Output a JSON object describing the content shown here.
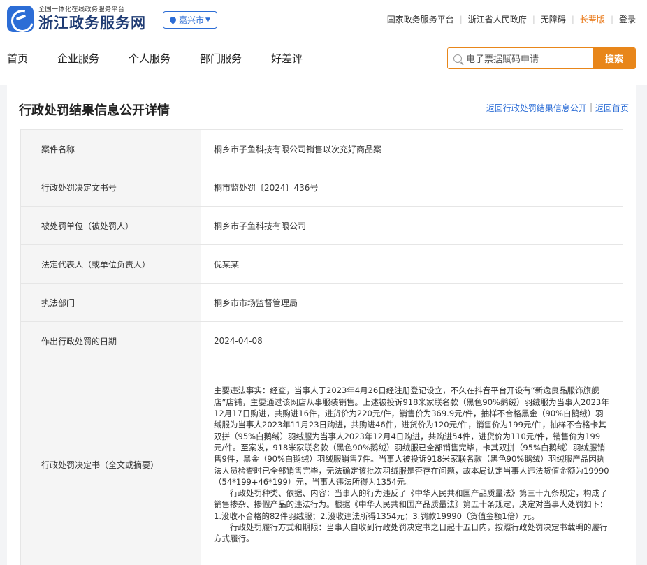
{
  "header": {
    "logo_sub": "全国一体化在线政务服务平台",
    "logo_main": "浙江政务服务网",
    "region": "嘉兴市",
    "links": [
      "国家政务服务平台",
      "浙江省人民政府",
      "无障碍",
      "长辈版",
      "登录"
    ]
  },
  "nav": {
    "items": [
      "首页",
      "企业服务",
      "个人服务",
      "部门服务",
      "好差评"
    ]
  },
  "search": {
    "placeholder": "电子票据赋码申请",
    "button": "搜索"
  },
  "page": {
    "title": "行政处罚结果信息公开详情",
    "back_list": "返回行政处罚结果信息公开",
    "back_home": "返回首页"
  },
  "details": [
    {
      "label": "案件名称",
      "value": "桐乡市子鱼科技有限公司销售以次充好商品案"
    },
    {
      "label": "行政处罚决定文书号",
      "value": "桐市监处罚〔2024〕436号"
    },
    {
      "label": "被处罚单位（被处罚人）",
      "value": "桐乡市子鱼科技有限公司"
    },
    {
      "label": "法定代表人（或单位负责人）",
      "value": "倪某某"
    },
    {
      "label": "执法部门",
      "value": "桐乡市市场监督管理局"
    },
    {
      "label": "作出行政处罚的日期",
      "value": "2024-04-08"
    }
  ],
  "decision": {
    "label": "行政处罚决定书（全文或摘要）",
    "paragraphs": [
      "主要违法事实：经查，当事人于2023年4月26日经注册登记设立，不久在抖音平台开设有“新逸良品服饰旗舰店”店铺，主要通过该网店从事服装销售。上述被投诉918米家联名款（黑色90%鹅绒）羽绒服为当事人2023年12月17日购进，共购进16件，进货价为220元/件，销售价为369.9元/件，抽样不合格黑金（90%白鹅绒）羽绒服为当事人2023年11月23日购进，共购进46件，进货价为120元/件，销售价为199元/件，抽样不合格卡其双拼（95%白鹅绒）羽绒服为当事人2023年12月4日购进，共购进54件，进货价为110元/件，销售价为199元/件。至案发，918米家联名款（黑色90%鹅绒）羽绒服已全部销售完毕，卡其双拼（95%白鹅绒）羽绒服销售9件，黑金（90%白鹅绒）羽绒服销售7件。当事人被投诉918米家联名款（黑色90%鹅绒）羽绒服产品因执法人员检查时已全部销售完毕，无法确定该批次羽绒服是否存在问题，故本局认定当事人违法货值金额为19990（54*199+46*199）元，当事人违法所得为1354元。",
      "行政处罚种类、依据、内容：当事人的行为违反了《中华人民共和国产品质量法》第三十九条规定，构成了销售掺杂、掺假产品的违法行为。根据《中华人民共和国产品质量法》第五十条规定，决定对当事人处罚如下：1.没收不合格的82件羽绒服；2.没收违法所得1354元；3.罚款19990（货值金额1倍）元。",
      "行政处罚履行方式和期限：当事人自收到行政处罚决定书之日起十五日内，按照行政处罚决定书载明的履行方式履行。"
    ]
  }
}
